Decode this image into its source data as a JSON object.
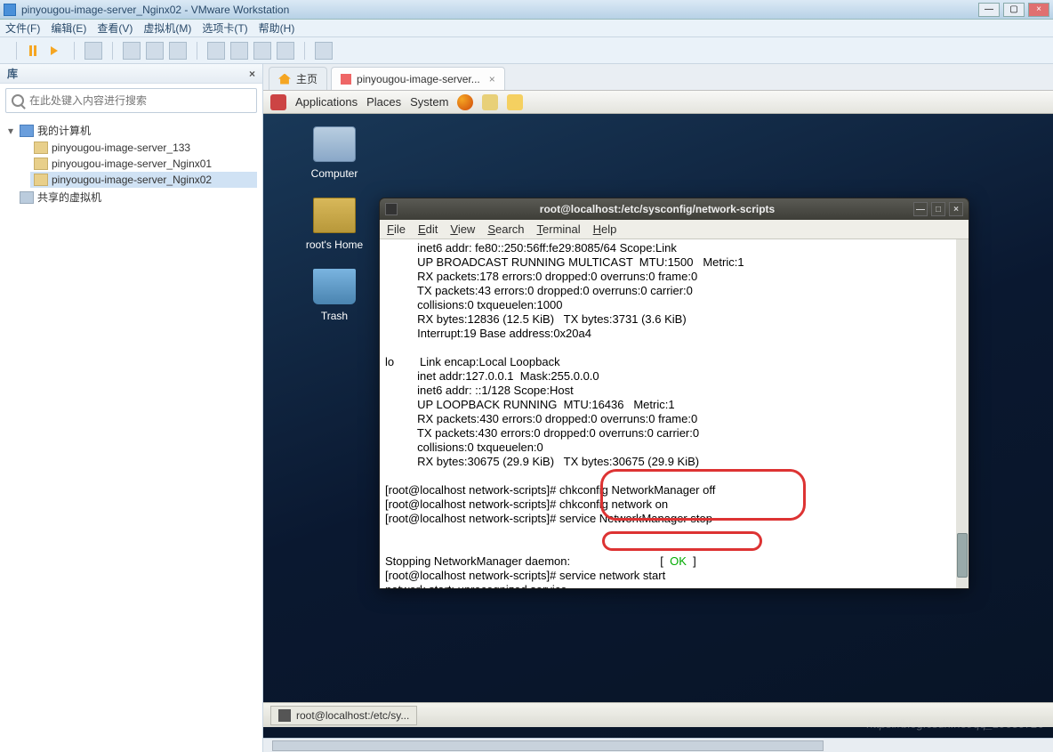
{
  "window": {
    "title": "pinyougou-image-server_Nginx02 - VMware Workstation",
    "min_label": "—",
    "max_label": "▢",
    "close_label": "×"
  },
  "menubar": {
    "file": "文件(F)",
    "edit": "编辑(E)",
    "view": "查看(V)",
    "vm": "虚拟机(M)",
    "tabs": "选项卡(T)",
    "help": "帮助(H)"
  },
  "library": {
    "title": "库",
    "close": "×",
    "search_placeholder": "在此处键入内容进行搜索",
    "root": "我的计算机",
    "items": [
      "pinyougou-image-server_133",
      "pinyougou-image-server_Nginx01",
      "pinyougou-image-server_Nginx02"
    ],
    "shared": "共享的虚拟机"
  },
  "tabs": {
    "home": "主页",
    "vm": "pinyougou-image-server...",
    "close": "×"
  },
  "gnome": {
    "applications": "Applications",
    "places": "Places",
    "system": "System"
  },
  "desktop": {
    "computer": "Computer",
    "home": "root's Home",
    "trash": "Trash"
  },
  "terminal": {
    "title": "root@localhost:/etc/sysconfig/network-scripts",
    "menu": {
      "file": "File",
      "edit": "Edit",
      "view": "View",
      "search": "Search",
      "terminal": "Terminal",
      "help": "Help"
    },
    "min": "—",
    "max": "□",
    "close": "×",
    "lines": [
      "          inet6 addr: fe80::250:56ff:fe29:8085/64 Scope:Link",
      "          UP BROADCAST RUNNING MULTICAST  MTU:1500   Metric:1",
      "          RX packets:178 errors:0 dropped:0 overruns:0 frame:0",
      "          TX packets:43 errors:0 dropped:0 overruns:0 carrier:0",
      "          collisions:0 txqueuelen:1000",
      "          RX bytes:12836 (12.5 KiB)   TX bytes:3731 (3.6 KiB)",
      "          Interrupt:19 Base address:0x20a4",
      "",
      "lo        Link encap:Local Loopback",
      "          inet addr:127.0.0.1  Mask:255.0.0.0",
      "          inet6 addr: ::1/128 Scope:Host",
      "          UP LOOPBACK RUNNING  MTU:16436   Metric:1",
      "          RX packets:430 errors:0 dropped:0 overruns:0 frame:0",
      "          TX packets:430 errors:0 dropped:0 overruns:0 carrier:0",
      "          collisions:0 txqueuelen:0",
      "          RX bytes:30675 (29.9 KiB)   TX bytes:30675 (29.9 KiB)",
      "",
      "[root@localhost network-scripts]# chkconfig NetworkManager off",
      "[root@localhost network-scripts]# chkconfig network on",
      "[root@localhost network-scripts]# service NetworkManager stop"
    ],
    "stop_line_prefix": "Stopping NetworkManager daemon:                            [  ",
    "stop_ok": "OK",
    "stop_line_suffix": "  ]",
    "start_line": "[root@localhost network-scripts]# service network start",
    "unrec_line": "network start: unrecognized service",
    "prompt": "[root@localhost network-scripts]# "
  },
  "taskbar": {
    "item": "root@localhost:/etc/sy..."
  },
  "watermark": "https://blog.csdn.net/qq_19630726"
}
